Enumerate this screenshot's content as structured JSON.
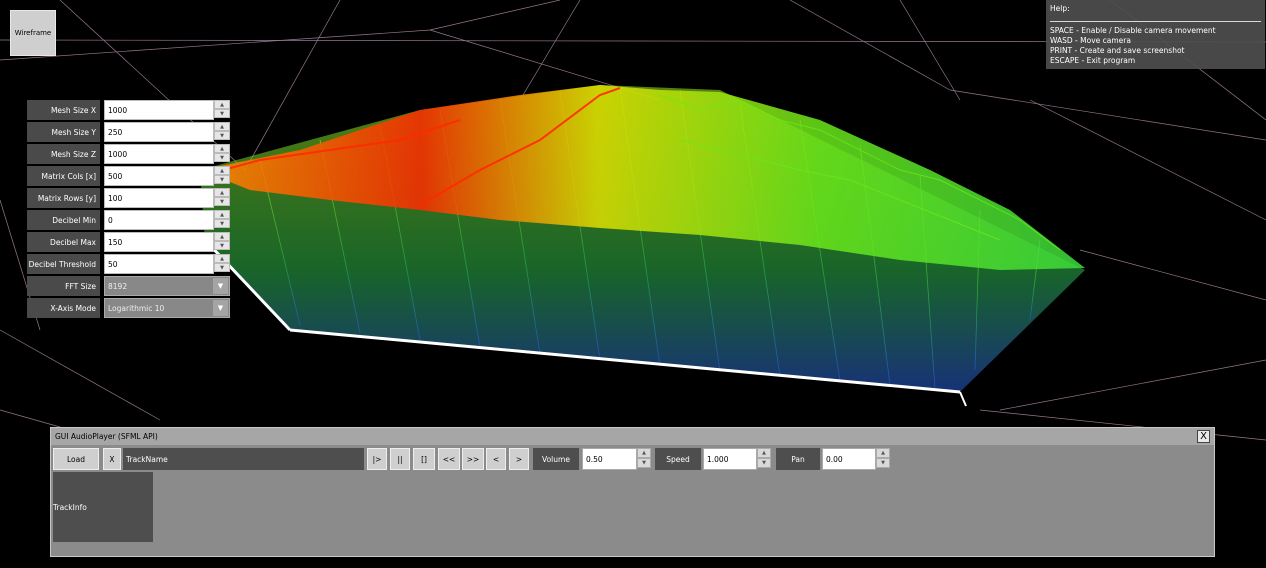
{
  "toolbar": {
    "wireframe_label": "Wireframe"
  },
  "help": {
    "title": "Help:",
    "lines": [
      "SPACE - Enable / Disable camera movement",
      "WASD - Move camera",
      "PRINT - Create and save screenshot",
      "ESCAPE - Exit program"
    ]
  },
  "params": {
    "mesh_size_x": {
      "label": "Mesh Size X",
      "value": "1000"
    },
    "mesh_size_y": {
      "label": "Mesh Size Y",
      "value": "250"
    },
    "mesh_size_z": {
      "label": "Mesh Size Z",
      "value": "1000"
    },
    "matrix_cols": {
      "label": "Matrix Cols [x]",
      "value": "500"
    },
    "matrix_rows": {
      "label": "Matrix Rows [y]",
      "value": "100"
    },
    "decibel_min": {
      "label": "Decibel Min",
      "value": "0"
    },
    "decibel_max": {
      "label": "Decibel Max",
      "value": "150"
    },
    "decibel_threshold": {
      "label": "Decibel Threshold",
      "value": "50"
    },
    "fft_size": {
      "label": "FFT Size",
      "value": "8192"
    },
    "x_axis_mode": {
      "label": "X-Axis Mode",
      "value": "Logarithmic 10"
    }
  },
  "player": {
    "title": "GUI AudioPlayer (SFML API)",
    "close_label": "X",
    "load_label": "Load",
    "clear_label": "X",
    "track_name": "TrackName",
    "play_label": "|>",
    "pause_label": "||",
    "stop_label": "[]",
    "rewind_label": "<<",
    "forward_label": ">>",
    "prev_label": "<",
    "next_label": ">",
    "volume_label": "Volume",
    "volume_value": "0.50",
    "speed_label": "Speed",
    "speed_value": "1.000",
    "pan_label": "Pan",
    "pan_value": "0.00",
    "track_info": "TrackInfo"
  },
  "colors": {
    "spectrum_low": "#2a5ad8",
    "spectrum_mid": "#6ae81a",
    "spectrum_high": "#ff1a00",
    "grid_lines": "#c9a0c0",
    "background": "#000000"
  }
}
